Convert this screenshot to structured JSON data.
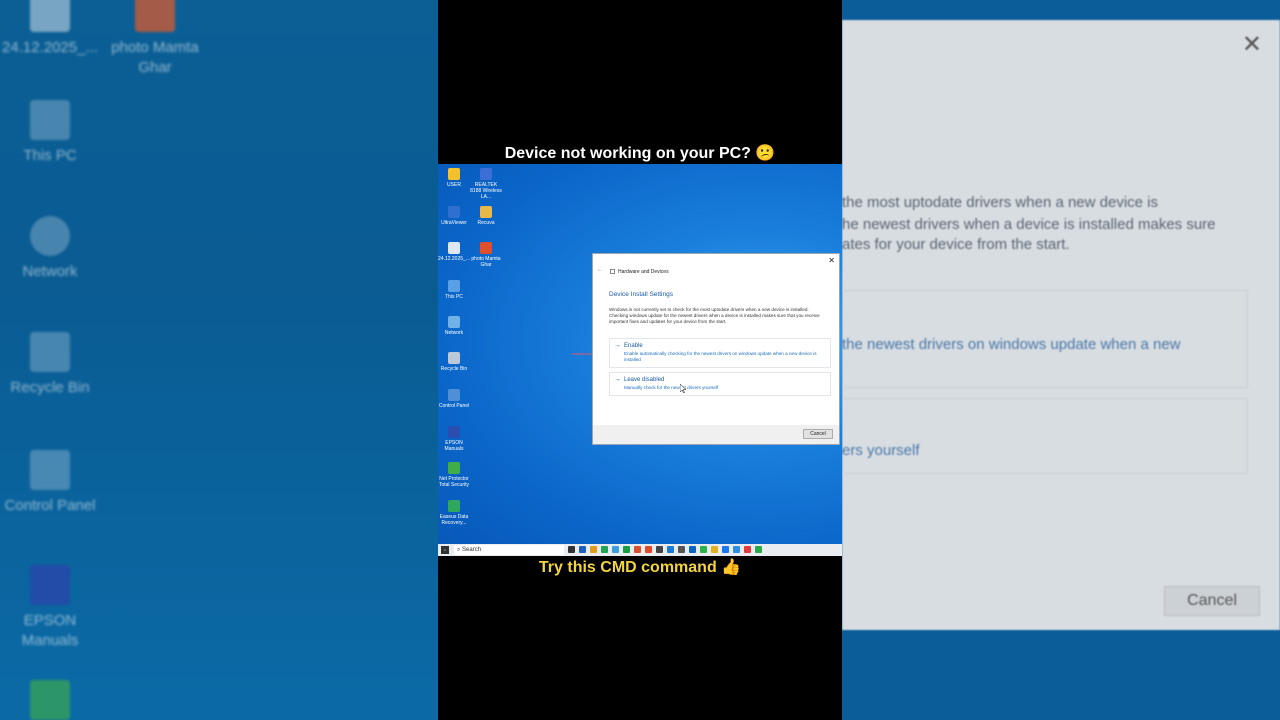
{
  "captions": {
    "top": "Device not working on your PC? 😕",
    "bottom": "Try this CMD command 👍"
  },
  "background_left": {
    "icons": [
      {
        "label": "24.12.2025_..."
      },
      {
        "label": "photo Mamta Ghar"
      },
      {
        "label": "This PC"
      },
      {
        "label": "Network"
      },
      {
        "label": "Recycle Bin"
      },
      {
        "label": "Control Panel"
      },
      {
        "label": "EPSON Manuals"
      }
    ]
  },
  "background_right": {
    "lines": [
      "the most uptodate drivers when a new device is",
      "he newest drivers when a device is installed makes sure",
      "ates for your device from the start."
    ],
    "link1": "the newest drivers on windows update when a new",
    "link2": "ers yourself",
    "cancel": "Cancel"
  },
  "desktop": {
    "icons": [
      {
        "label": "USER",
        "color": "#f2c12e"
      },
      {
        "label": "REALTEK 8188 Wireless LA...",
        "color": "#3c6fd6"
      },
      {
        "label": "UltraViewer",
        "color": "#2f6fd0"
      },
      {
        "label": "Recuva",
        "color": "#e8b84a"
      },
      {
        "label": "24.12.2025_...",
        "color": "#dfe7f0"
      },
      {
        "label": "photo Mamta Ghar",
        "color": "#e0502a"
      },
      {
        "label": "This PC",
        "color": "#5aa0e6"
      },
      {
        "label": "Network",
        "color": "#6fb2e8"
      },
      {
        "label": "Recycle Bin",
        "color": "#b9c9d8"
      },
      {
        "label": "Control Panel",
        "color": "#4f8fd6"
      },
      {
        "label": "EPSON Manuals",
        "color": "#2a4db0"
      },
      {
        "label": "Net Protector Total Security",
        "color": "#3fae49"
      },
      {
        "label": "Easeus Data Recovery...",
        "color": "#2fa85e"
      }
    ],
    "taskbar": {
      "search_placeholder": "Search",
      "icon_colors": [
        "#333",
        "#1f5fb8",
        "#e39b1a",
        "#22a552",
        "#3aa0e0",
        "#1a9c45",
        "#d9502a",
        "#e04a2a",
        "#444",
        "#1c7cd6",
        "#555",
        "#0a66c2",
        "#2bb34a",
        "#e0b020",
        "#1877f2",
        "#2c8fe0",
        "#e03a3a",
        "#2aa84a"
      ]
    }
  },
  "dialog": {
    "window_title": "Hardware and Devices",
    "heading": "Device Install Settings",
    "description": "Windows is not currently set to check for the most uptodate drivers when a new device is installed. Checking windows update for the newest drivers when a device is installed makes sure that you receive important fixes and updates for your device from the start.",
    "options": [
      {
        "title": "Enable",
        "desc": "Enable automatically checking for the newest drivers on windows update when a new device is installed"
      },
      {
        "title": "Leave disabled",
        "desc": "Manually check for the newest drivers yourself"
      }
    ],
    "cancel_label": "Cancel",
    "close_glyph": "✕",
    "back_glyph": "←",
    "arrow_glyph": "→"
  }
}
